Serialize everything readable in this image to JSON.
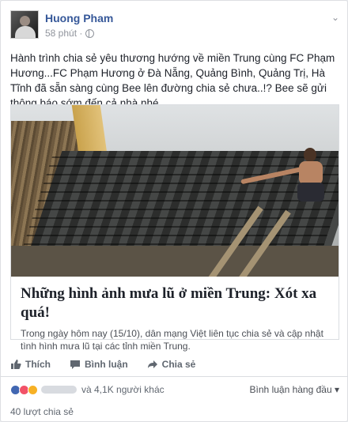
{
  "post": {
    "author": "Huong Pham",
    "time": "58 phút ·",
    "text": "Hành trình chia sẻ yêu thương hướng về miền Trung cùng FC Phạm Hương...FC Phạm Hương ở Đà Nẵng, Quảng Bình, Quảng Trị, Hà Tĩnh đã sẵn sàng cùng Bee lên đường chia sẻ chưa..!? Bee sẽ gửi thông báo sớm đến cả nhà nhé..."
  },
  "link": {
    "title": "Những hình ảnh mưa lũ ở miền Trung: Xót xa quá!",
    "description": "Trong ngày hôm nay (15/10), dân mạng Việt liên tục chia sẻ và cập nhật tình hình mưa lũ tại các tỉnh miền Trung."
  },
  "actions": {
    "like": "Thích",
    "comment": "Bình luận",
    "share": "Chia sẻ"
  },
  "reactions": {
    "others": "và 4,1K người khác",
    "sort": "Bình luận hàng đầu ▾",
    "shares": "40 lượt chia sẻ"
  },
  "colors": {
    "name": "#365899",
    "muted": "#90949c",
    "like": "#4267b2",
    "love": "#f25268",
    "sad": "#f7b125"
  },
  "icons": [
    "globe-icon",
    "chevron-down-icon",
    "thumbs-up-icon",
    "comment-icon",
    "share-arrow-icon"
  ]
}
